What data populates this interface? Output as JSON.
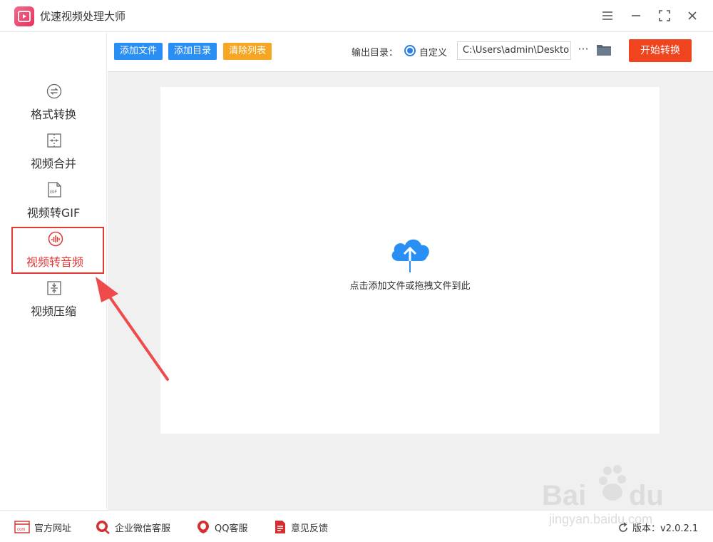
{
  "titlebar": {
    "title": "优速视频处理大师"
  },
  "sidebar": {
    "items": [
      {
        "label": "格式转换",
        "icon": "format-convert-icon",
        "active": false
      },
      {
        "label": "视频合并",
        "icon": "merge-icon",
        "active": false
      },
      {
        "label": "视频转GIF",
        "icon": "gif-icon",
        "active": false
      },
      {
        "label": "视频转音频",
        "icon": "audio-icon",
        "active": true
      },
      {
        "label": "视频压缩",
        "icon": "compress-icon",
        "active": false
      }
    ]
  },
  "toolbar": {
    "add_file": "添加文件",
    "add_dir": "添加目录",
    "clear_list": "清除列表",
    "output_label": "输出目录：",
    "radio_label": "自定义",
    "output_path": "C:\\Users\\admin\\Deskto",
    "more": "···",
    "start": "开始转换"
  },
  "dropzone": {
    "hint": "点击添加文件或拖拽文件到此"
  },
  "footer": {
    "website": "官方网址",
    "wechat": "企业微信客服",
    "qq": "QQ客服",
    "feedback": "意见反馈",
    "version": "版本：v2.0.2.1"
  },
  "colors": {
    "primary_blue": "#2a8ff4",
    "orange": "#f5a623",
    "start_red": "#f0441e",
    "accent_red": "#e53935"
  }
}
